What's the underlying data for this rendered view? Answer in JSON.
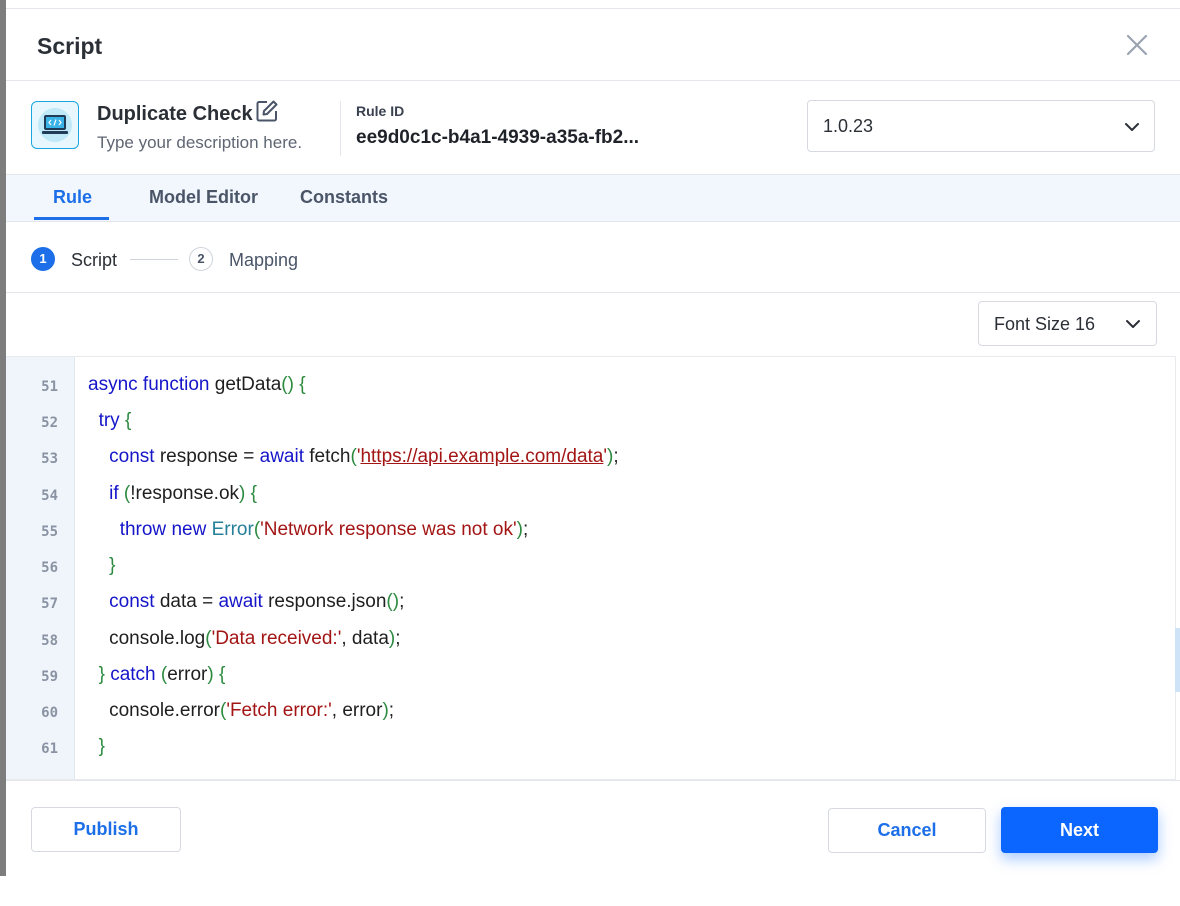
{
  "modal": {
    "title": "Script"
  },
  "rule": {
    "name": "Duplicate Check",
    "description": "Type your description here.",
    "id_label": "Rule ID",
    "id_value": "ee9d0c1c-b4a1-4939-a35a-fb2...",
    "version": "1.0.23"
  },
  "tabs": [
    {
      "label": "Rule",
      "active": true
    },
    {
      "label": "Model Editor",
      "active": false
    },
    {
      "label": "Constants",
      "active": false
    }
  ],
  "steps": [
    {
      "number": "1",
      "label": "Script",
      "status": "current"
    },
    {
      "number": "2",
      "label": "Mapping",
      "status": "pending"
    }
  ],
  "editor": {
    "font_size_label": "Font Size 16",
    "line_numbers": [
      "51",
      "52",
      "53",
      "54",
      "55",
      "56",
      "57",
      "58",
      "59",
      "60",
      "61"
    ],
    "lines": [
      "async function getData() {",
      "  try {",
      "    const response = await fetch('https://api.example.com/data');",
      "    if (!response.ok) {",
      "      throw new Error('Network response was not ok');",
      "    }",
      "    const data = await response.json();",
      "    console.log('Data received:', data);",
      "  } catch (error) {",
      "    console.error('Fetch error:', error);",
      "  }"
    ]
  },
  "footer": {
    "publish_label": "Publish",
    "cancel_label": "Cancel",
    "next_label": "Next"
  },
  "icons": {
    "close": "close-icon",
    "edit": "edit-icon",
    "app": "code-screen-icon",
    "dropdown": "chevron-down-icon"
  },
  "colors": {
    "accent": "#1c6fe8",
    "primary_button": "#0a66ff",
    "tab_bar": "#f2f6fd"
  }
}
